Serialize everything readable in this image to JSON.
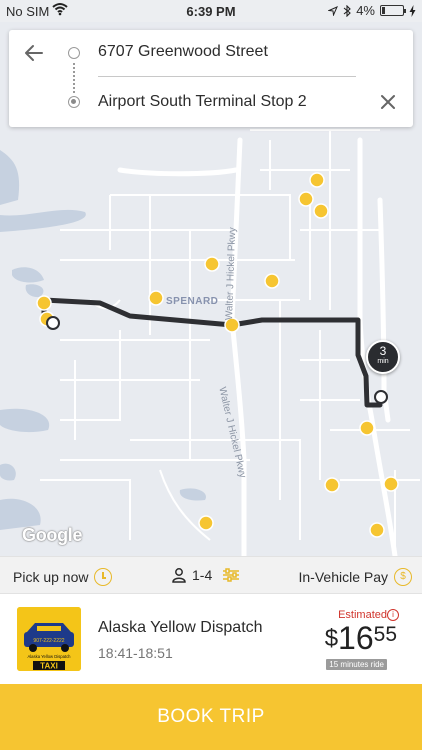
{
  "status_bar": {
    "carrier": "No SIM",
    "time": "6:39 PM",
    "battery": "4%"
  },
  "route": {
    "origin": "6707 Greenwood Street",
    "destination": "Airport South Terminal Stop 2"
  },
  "map": {
    "google_label": "Google",
    "area_label": "SPENARD",
    "road_labels": [
      "Walter J Hickel Pkwy",
      "Walter J Hickel Pkwy"
    ],
    "eta_value": "3",
    "eta_unit": "min",
    "colors": {
      "route": "#2e2f33",
      "marker": "#f6c531",
      "road": "#ffffff",
      "background": "#e8ebf0",
      "water": "#c6d1e0"
    }
  },
  "options": {
    "pickup_label": "Pick up now",
    "passengers_label": "1-4",
    "payment_label": "In-Vehicle Pay"
  },
  "provider": {
    "name": "Alaska Yellow Dispatch",
    "time_range": "18:41-18:51",
    "logo_text_top": "Alaska Yellow Dispatch",
    "logo_text_taxi": "TAXI",
    "logo_phone": "907-222-2222",
    "estimated_label": "Estimated",
    "price_dollar": "$",
    "price_whole": "16",
    "price_cents": "55",
    "ride_duration": "15 minutes ride"
  },
  "book_button": {
    "label": "BOOK TRIP"
  },
  "icons": [
    "back-arrow-icon",
    "close-icon",
    "clock-icon",
    "person-icon",
    "filter-icon",
    "coin-icon",
    "info-icon",
    "wifi-icon",
    "location-arrow-icon",
    "bluetooth-icon",
    "battery-icon",
    "charging-icon"
  ]
}
